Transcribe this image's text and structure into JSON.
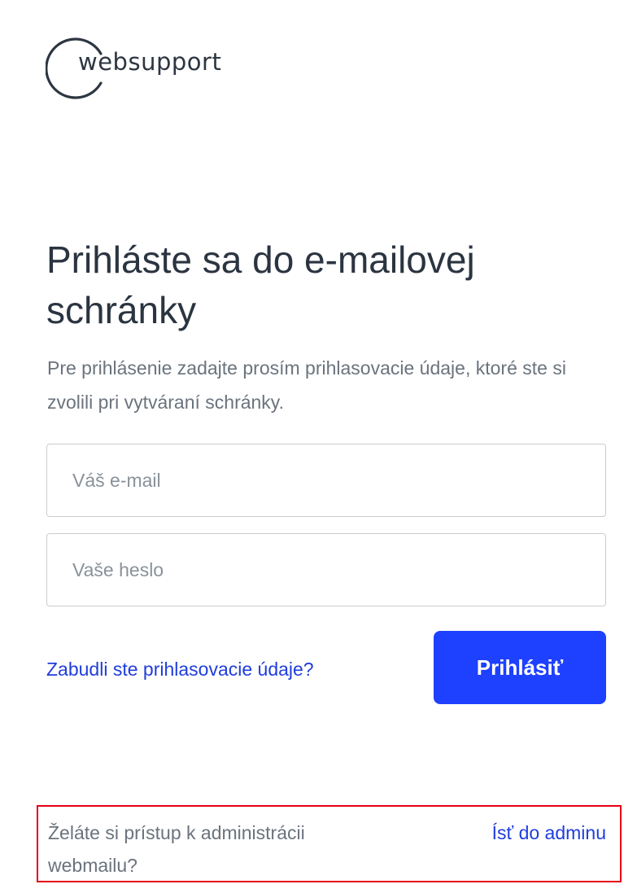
{
  "brand": {
    "name": "websupport",
    "logo_text": "websupport"
  },
  "login": {
    "title": "Prihláste sa do e-mailovej schránky",
    "subtitle": "Pre prihlásenie zadajte prosím prihlasovacie údaje, ktoré ste si zvolili pri vytváraní schránky.",
    "email_placeholder": "Váš e-mail",
    "email_value": "",
    "password_placeholder": "Vaše heslo",
    "password_value": "",
    "forgot_label": "Zabudli ste prihlasovacie údaje?",
    "submit_label": "Prihlásiť"
  },
  "admin": {
    "question": "Želáte si prístup k administrácii webmailu?",
    "link_label": "Ísť do adminu"
  },
  "colors": {
    "accent": "#1e40ff",
    "link": "#1f3ddc",
    "text": "#2b3441",
    "muted": "#6b737d",
    "highlight_border": "#e60012"
  }
}
